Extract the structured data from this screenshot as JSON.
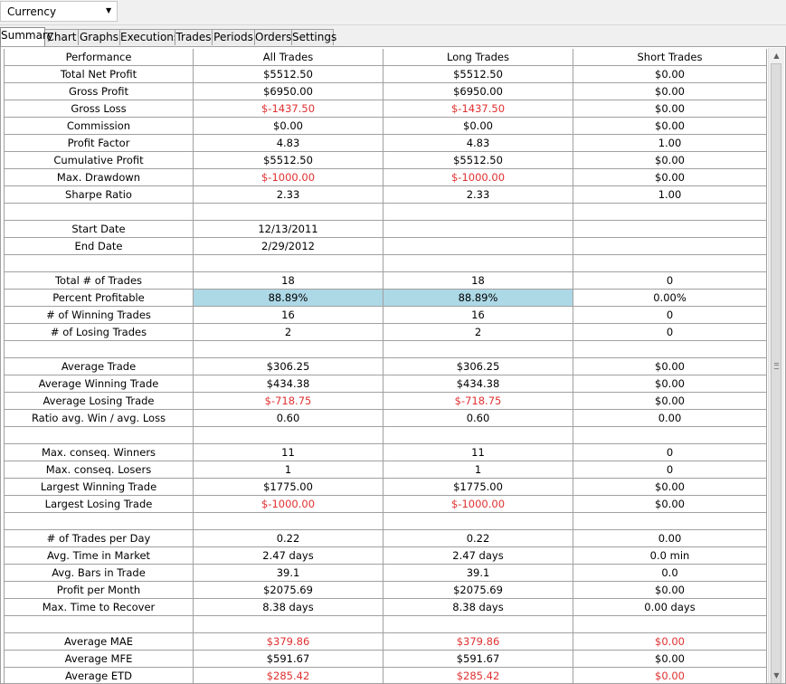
{
  "dropdown": {
    "value": "Currency"
  },
  "tabs": [
    "Summary",
    "Chart",
    "Graphs",
    "Executions",
    "Trades",
    "Periods",
    "Orders",
    "Settings"
  ],
  "active_tab": "Summary",
  "table": {
    "headers": [
      "Performance",
      "All Trades",
      "Long Trades",
      "Short Trades"
    ],
    "rows": [
      {
        "label": "Total Net Profit",
        "values": [
          "$5512.50",
          "$5512.50",
          "$0.00"
        ]
      },
      {
        "label": "Gross Profit",
        "values": [
          "$6950.00",
          "$6950.00",
          "$0.00"
        ]
      },
      {
        "label": "Gross Loss",
        "values": [
          "$-1437.50",
          "$-1437.50",
          "$0.00"
        ],
        "neg": [
          true,
          true,
          false
        ]
      },
      {
        "label": "Commission",
        "values": [
          "$0.00",
          "$0.00",
          "$0.00"
        ]
      },
      {
        "label": "Profit Factor",
        "values": [
          "4.83",
          "4.83",
          "1.00"
        ]
      },
      {
        "label": "Cumulative Profit",
        "values": [
          "$5512.50",
          "$5512.50",
          "$0.00"
        ]
      },
      {
        "label": "Max. Drawdown",
        "values": [
          "$-1000.00",
          "$-1000.00",
          "$0.00"
        ],
        "neg": [
          true,
          true,
          false
        ]
      },
      {
        "label": "Sharpe Ratio",
        "values": [
          "2.33",
          "2.33",
          "1.00"
        ]
      },
      {
        "label": "",
        "values": [
          "",
          "",
          ""
        ]
      },
      {
        "label": "Start Date",
        "values": [
          "12/13/2011",
          "",
          ""
        ]
      },
      {
        "label": "End Date",
        "values": [
          "2/29/2012",
          "",
          ""
        ]
      },
      {
        "label": "",
        "values": [
          "",
          "",
          ""
        ]
      },
      {
        "label": "Total # of Trades",
        "values": [
          "18",
          "18",
          "0"
        ]
      },
      {
        "label": "Percent Profitable",
        "values": [
          "88.89%",
          "88.89%",
          "0.00%"
        ],
        "highlight": [
          true,
          true,
          false
        ]
      },
      {
        "label": "# of Winning Trades",
        "values": [
          "16",
          "16",
          "0"
        ]
      },
      {
        "label": "# of Losing Trades",
        "values": [
          "2",
          "2",
          "0"
        ]
      },
      {
        "label": "",
        "values": [
          "",
          "",
          ""
        ]
      },
      {
        "label": "Average Trade",
        "values": [
          "$306.25",
          "$306.25",
          "$0.00"
        ]
      },
      {
        "label": "Average Winning Trade",
        "values": [
          "$434.38",
          "$434.38",
          "$0.00"
        ]
      },
      {
        "label": "Average Losing Trade",
        "values": [
          "$-718.75",
          "$-718.75",
          "$0.00"
        ],
        "neg": [
          true,
          true,
          false
        ]
      },
      {
        "label": "Ratio avg. Win / avg. Loss",
        "values": [
          "0.60",
          "0.60",
          "0.00"
        ]
      },
      {
        "label": "",
        "values": [
          "",
          "",
          ""
        ]
      },
      {
        "label": "Max. conseq. Winners",
        "values": [
          "11",
          "11",
          "0"
        ]
      },
      {
        "label": "Max. conseq. Losers",
        "values": [
          "1",
          "1",
          "0"
        ]
      },
      {
        "label": "Largest Winning Trade",
        "values": [
          "$1775.00",
          "$1775.00",
          "$0.00"
        ]
      },
      {
        "label": "Largest Losing Trade",
        "values": [
          "$-1000.00",
          "$-1000.00",
          "$0.00"
        ],
        "neg": [
          true,
          true,
          false
        ]
      },
      {
        "label": "",
        "values": [
          "",
          "",
          ""
        ]
      },
      {
        "label": "# of Trades per Day",
        "values": [
          "0.22",
          "0.22",
          "0.00"
        ]
      },
      {
        "label": "Avg. Time in Market",
        "values": [
          "2.47 days",
          "2.47 days",
          "0.0 min"
        ]
      },
      {
        "label": "Avg. Bars in Trade",
        "values": [
          "39.1",
          "39.1",
          "0.0"
        ]
      },
      {
        "label": "Profit per Month",
        "values": [
          "$2075.69",
          "$2075.69",
          "$0.00"
        ]
      },
      {
        "label": "Max. Time to Recover",
        "values": [
          "8.38 days",
          "8.38 days",
          "0.00 days"
        ]
      },
      {
        "label": "",
        "values": [
          "",
          "",
          ""
        ]
      },
      {
        "label": "Average MAE",
        "values": [
          "$379.86",
          "$379.86",
          "$0.00"
        ],
        "neg": [
          true,
          true,
          true
        ]
      },
      {
        "label": "Average MFE",
        "values": [
          "$591.67",
          "$591.67",
          "$0.00"
        ]
      },
      {
        "label": "Average ETD",
        "values": [
          "$285.42",
          "$285.42",
          "$0.00"
        ],
        "neg": [
          true,
          true,
          true
        ]
      }
    ]
  }
}
